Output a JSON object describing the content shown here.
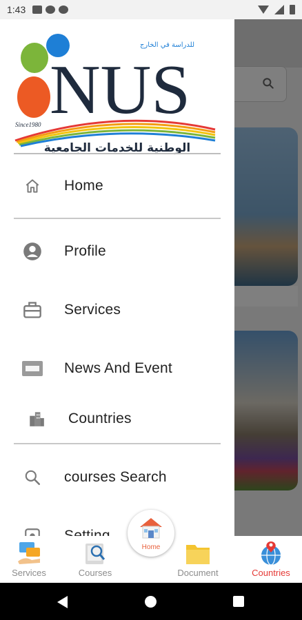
{
  "status_bar": {
    "time": "1:43"
  },
  "drawer": {
    "logo": {
      "wordmark": "NUS",
      "arabic_tagline": "للدراسة في الخارج",
      "since": "Since1980",
      "arabic_name": "الوطنية للخدمات الجامعية"
    },
    "items": [
      {
        "label": "Home",
        "icon": "home-icon"
      },
      {
        "label": "Profile",
        "icon": "profile-icon"
      },
      {
        "label": "Services",
        "icon": "briefcase-icon"
      },
      {
        "label": "News And Event",
        "icon": "news-icon"
      },
      {
        "label": "Countries",
        "icon": "buildings-icon"
      },
      {
        "label": "courses Search",
        "icon": "search-icon"
      },
      {
        "label": "Setting",
        "icon": "settings-icon"
      }
    ]
  },
  "bottom_nav": {
    "items": [
      {
        "label": "Services",
        "icon": "services-icon",
        "active": false
      },
      {
        "label": "Courses",
        "icon": "courses-icon",
        "active": false
      },
      {
        "label": "Home",
        "icon": "home-house-icon",
        "active": false
      },
      {
        "label": "Document",
        "icon": "document-folder-icon",
        "active": false
      },
      {
        "label": "Countries",
        "icon": "globe-pin-icon",
        "active": true
      }
    ]
  },
  "colors": {
    "active": "#e53935",
    "inactive_label": "#8c8c8c",
    "menu_icon": "#7a7a7a",
    "logo_blue": "#1e7fd6",
    "logo_green": "#7cb53a",
    "logo_orange": "#ec5a24",
    "logo_navy": "#1f2b3d"
  }
}
